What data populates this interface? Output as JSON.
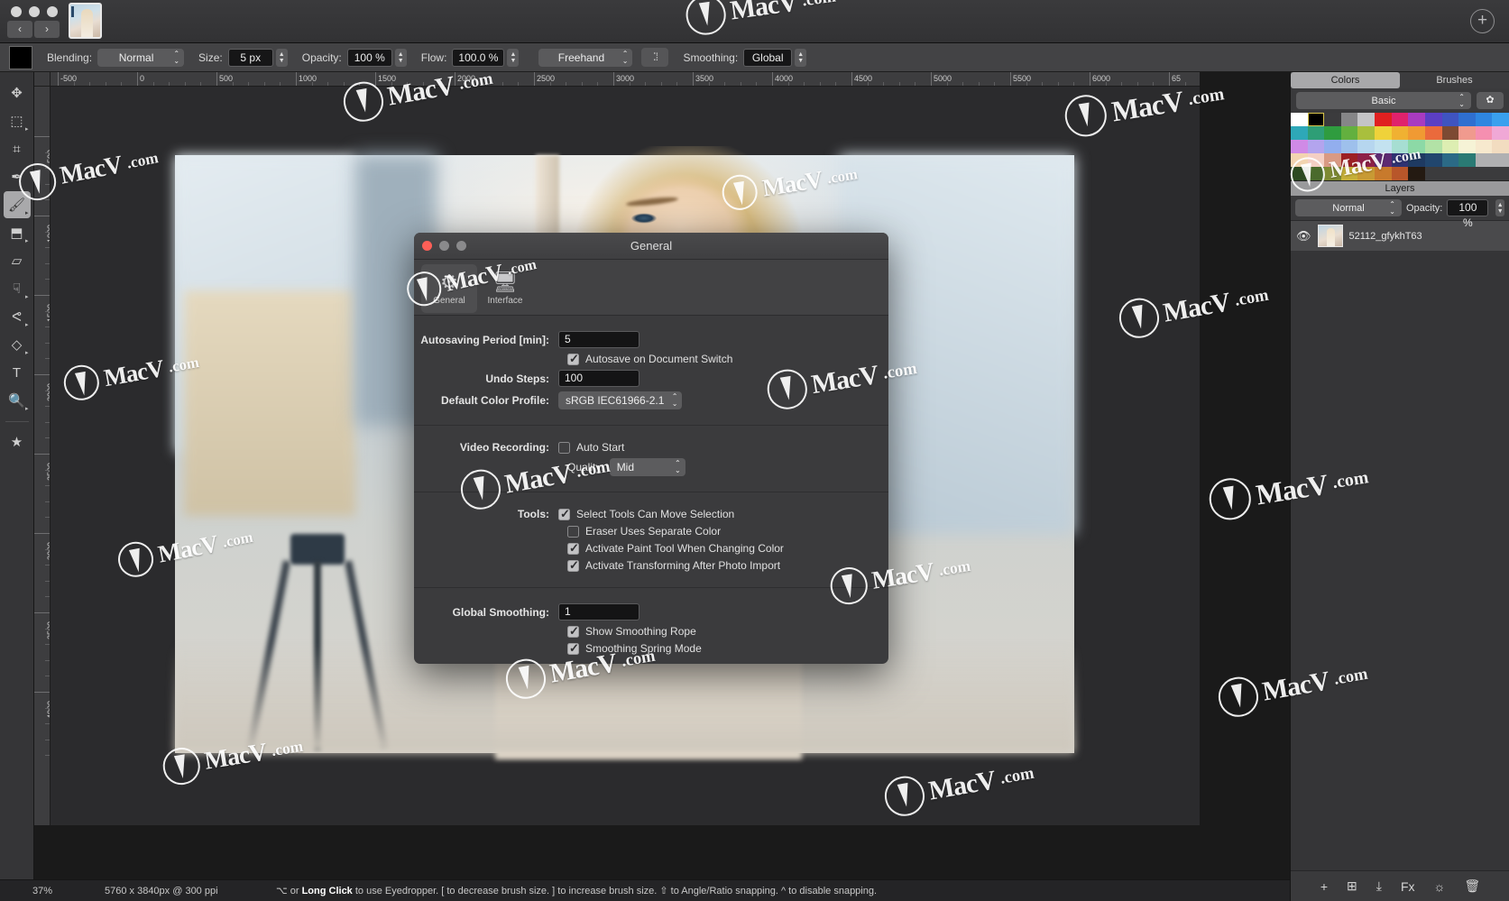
{
  "app": {
    "title_bar": {
      "back_label": "‹",
      "forward_label": "›",
      "add_label": "+"
    }
  },
  "options_bar": {
    "blending_label": "Blending:",
    "blending_value": "Normal",
    "size_label": "Size:",
    "size_value": "5 px",
    "opacity_label": "Opacity:",
    "opacity_value": "100 %",
    "flow_label": "Flow:",
    "flow_value": "100.0 %",
    "stroke_mode_value": "Freehand",
    "dots_button_label": "⁚⁞",
    "smoothing_label": "Smoothing:",
    "smoothing_value": "Global"
  },
  "tools": [
    {
      "name": "move-tool",
      "glyph": "✥",
      "selected": false,
      "submenu": false
    },
    {
      "name": "marquee-select-tool",
      "glyph": "⬚",
      "selected": false,
      "submenu": true
    },
    {
      "name": "crop-tool",
      "glyph": "⌗",
      "selected": false,
      "submenu": false
    },
    {
      "name": "eyedropper-tool",
      "glyph": "✒",
      "selected": false,
      "submenu": false
    },
    {
      "name": "brush-tool",
      "glyph": "🖌",
      "selected": true,
      "submenu": true
    },
    {
      "name": "clone-stamp-tool",
      "glyph": "⬒",
      "selected": false,
      "submenu": true
    },
    {
      "name": "eraser-tool",
      "glyph": "▱",
      "selected": false,
      "submenu": false
    },
    {
      "name": "smudge-tool",
      "glyph": "☟",
      "selected": false,
      "submenu": true
    },
    {
      "name": "blur-tool",
      "glyph": "ᕙ",
      "selected": false,
      "submenu": true
    },
    {
      "name": "shape-tool",
      "glyph": "◇",
      "selected": false,
      "submenu": true
    },
    {
      "name": "text-tool",
      "glyph": "T",
      "selected": false,
      "submenu": false
    },
    {
      "name": "zoom-tool",
      "glyph": "🔍",
      "selected": false,
      "submenu": true
    },
    {
      "name": "favorites-tool",
      "glyph": "★",
      "selected": false,
      "submenu": false
    }
  ],
  "rulers": {
    "horizontal_labels": [
      "-500",
      "0",
      "500",
      "1000",
      "1500",
      "2000",
      "2500",
      "3000",
      "3500",
      "4000",
      "4500",
      "5000",
      "5500",
      "6000",
      "65"
    ],
    "vertical_labels": [
      "500",
      "1000",
      "1500",
      "2000",
      "2500",
      "3000",
      "3500",
      "4000"
    ]
  },
  "preferences_dialog": {
    "title": "General",
    "tabs": [
      {
        "label": "General",
        "icon": "gear-icon",
        "active": true
      },
      {
        "label": "Interface",
        "icon": "display-icon",
        "active": false
      }
    ],
    "sections": [
      {
        "rows": [
          {
            "type": "text",
            "label": "Autosaving Period [min]:",
            "value": "5"
          },
          {
            "type": "checkbox",
            "label": "Autosave on Document Switch",
            "checked": true
          },
          {
            "type": "text",
            "label": "Undo Steps:",
            "value": "100"
          },
          {
            "type": "select",
            "label": "Default Color Profile:",
            "value": "sRGB IEC61966-2.1"
          }
        ]
      },
      {
        "rows": [
          {
            "type": "checkbox_labeled",
            "label": "Video Recording:",
            "text": "Auto Start",
            "checked": false
          },
          {
            "type": "select_inline",
            "label": "Quality:",
            "value": "Mid"
          }
        ]
      },
      {
        "rows": [
          {
            "type": "checkbox_labeled",
            "label": "Tools:",
            "text": "Select Tools Can Move Selection",
            "checked": true
          },
          {
            "type": "checkbox",
            "label": "Eraser Uses Separate Color",
            "checked": false
          },
          {
            "type": "checkbox",
            "label": "Activate Paint Tool When Changing Color",
            "checked": true
          },
          {
            "type": "checkbox",
            "label": "Activate Transforming After Photo Import",
            "checked": true
          }
        ]
      },
      {
        "rows": [
          {
            "type": "text",
            "label": "Global Smoothing:",
            "value": "1"
          },
          {
            "type": "checkbox",
            "label": "Show Smoothing Rope",
            "checked": true
          },
          {
            "type": "checkbox",
            "label": "Smoothing Spring Mode",
            "checked": true
          }
        ]
      }
    ]
  },
  "colors_panel": {
    "tabs": [
      {
        "label": "Colors",
        "active": true
      },
      {
        "label": "Brushes",
        "active": false
      }
    ],
    "preset": "Basic",
    "gear_icon": "gear-icon",
    "selected_swatch_index": 1,
    "swatches": [
      "#ffffff",
      "#000000",
      "#3b3b3d",
      "#868688",
      "#c4c4c6",
      "#e02020",
      "#e0226c",
      "#a83bc0",
      "#5b3fc4",
      "#3f54c0",
      "#2f6fd0",
      "#2f86e0",
      "#3aa0ee",
      "#2ea8b8",
      "#2e9e76",
      "#2f9c3f",
      "#63b03f",
      "#a9bf3d",
      "#efd23a",
      "#f0b132",
      "#f09a33",
      "#ea6a3c",
      "#7d4a33",
      "#f09a8e",
      "#f58fb0",
      "#f0a8d6",
      "#d08ae6",
      "#b3a4ee",
      "#92aeee",
      "#9ec0ec",
      "#b6d6ef",
      "#c3e2f0",
      "#a6ded2",
      "#8cd9a6",
      "#b2e2a6",
      "#ddeeb2",
      "#f6f3d6",
      "#f7e9ce",
      "#f2dcc0",
      "#f2d4b0",
      "#f4cfc4",
      "#d99a84",
      "#9c2024",
      "#8e2048",
      "#5e2a72",
      "#2e3272",
      "#1e3a62",
      "#21466e",
      "#2b6a86",
      "#2a7a74",
      "#b0b0b2",
      "#b0b0b2",
      "#2d4b22",
      "#4a6a2c",
      "#7e8a32",
      "#c6b03a",
      "#c89a34",
      "#c87a2c",
      "#b8562a",
      "#241a12",
      "#3b3b3d",
      "#3b3b3d",
      "#3b3b3d",
      "#3b3b3d",
      "#3b3b3d"
    ]
  },
  "layers_panel": {
    "header": "Layers",
    "blend_mode": "Normal",
    "opacity_label": "Opacity:",
    "opacity_value": "100 %",
    "layers": [
      {
        "name": "52112_gfykhT63",
        "visible": true,
        "visibility_icon": "eye-icon"
      }
    ],
    "footer_icons": [
      {
        "name": "add-layer-icon",
        "glyph": "+"
      },
      {
        "name": "add-group-icon",
        "glyph": "⊞"
      },
      {
        "name": "import-layer-icon",
        "glyph": "⤓"
      },
      {
        "name": "effects-icon",
        "glyph": "Fx"
      },
      {
        "name": "adjustments-icon",
        "glyph": "☼"
      },
      {
        "name": "delete-layer-icon",
        "glyph": "🗑"
      }
    ]
  },
  "status_bar": {
    "zoom": "37%",
    "dimensions": "5760 x 3840px @ 300 ppi",
    "hint_pre": "⌥ or ",
    "hint_bold": "Long Click",
    "hint_post": " to use Eyedropper.  [ to decrease brush size.  ] to increase brush size. ⇧ to Angle/Ratio snapping. ^ to disable snapping."
  },
  "watermark": {
    "text": "MacV",
    "domain": ".com"
  }
}
